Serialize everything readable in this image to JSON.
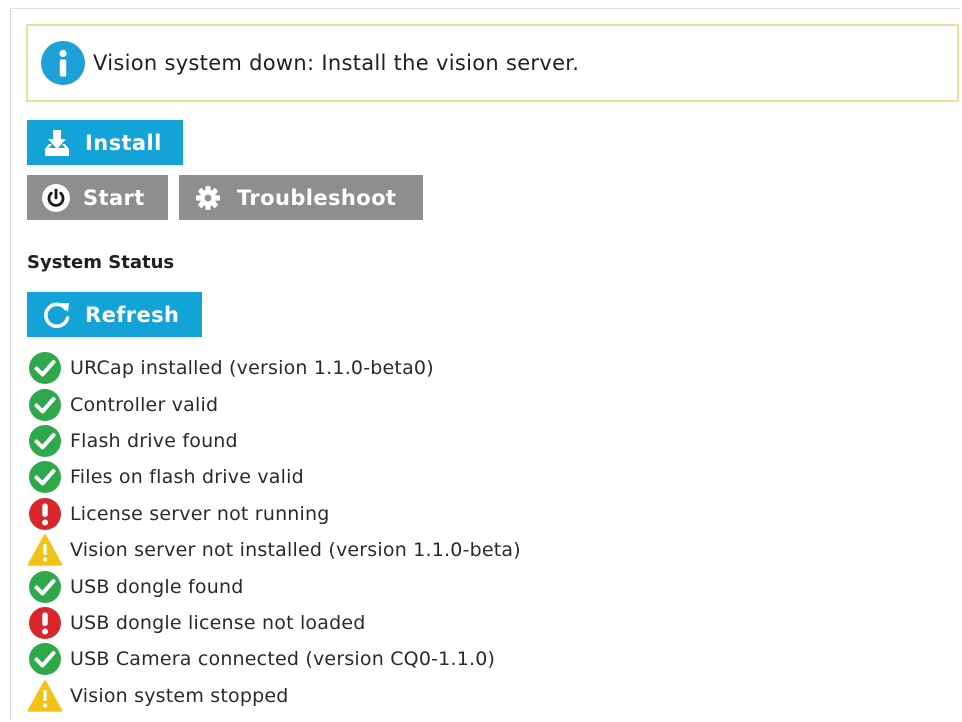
{
  "banner": {
    "icon": "info-icon",
    "message": "Vision system down: Install the vision server.",
    "border_color": "#ecdf9a"
  },
  "actions": {
    "install_label": "Install",
    "start_label": "Start",
    "troubleshoot_label": "Troubleshoot"
  },
  "status": {
    "section_title": "System Status",
    "refresh_label": "Refresh",
    "items": [
      {
        "state": "ok",
        "icon": "check-circle-icon",
        "text": "URCap installed (version 1.1.0-beta0)"
      },
      {
        "state": "ok",
        "icon": "check-circle-icon",
        "text": "Controller valid"
      },
      {
        "state": "ok",
        "icon": "check-circle-icon",
        "text": "Flash drive found"
      },
      {
        "state": "ok",
        "icon": "check-circle-icon",
        "text": "Files on flash drive valid"
      },
      {
        "state": "error",
        "icon": "error-circle-icon",
        "text": "License server not running"
      },
      {
        "state": "warning",
        "icon": "warning-triangle-icon",
        "text": "Vision server not installed (version 1.1.0-beta)"
      },
      {
        "state": "ok",
        "icon": "check-circle-icon",
        "text": "USB dongle found"
      },
      {
        "state": "error",
        "icon": "error-circle-icon",
        "text": "USB dongle license not loaded"
      },
      {
        "state": "ok",
        "icon": "check-circle-icon",
        "text": "USB Camera connected (version CQ0-1.1.0)"
      },
      {
        "state": "warning",
        "icon": "warning-triangle-icon",
        "text": "Vision system stopped"
      }
    ]
  },
  "colors": {
    "accent_blue": "#13a3d6",
    "button_gray": "#8e8e8e",
    "ok_green": "#2ea84a",
    "error_red": "#d9262d",
    "warning_yellow": "#f2c316"
  }
}
